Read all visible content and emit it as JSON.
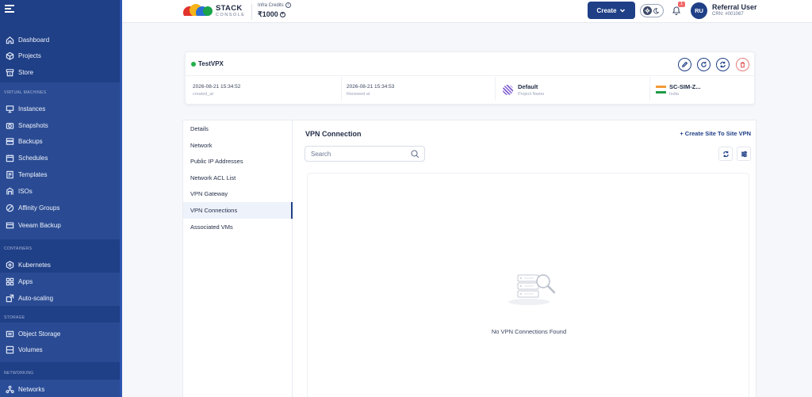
{
  "sidebar": {
    "items": [
      {
        "label": "Dashboard",
        "icon": "home-icon"
      },
      {
        "label": "Projects",
        "icon": "cube-icon"
      },
      {
        "label": "Store",
        "icon": "store-icon"
      }
    ],
    "sections": [
      {
        "title": "VIRTUAL MACHINES",
        "items": [
          {
            "label": "Instances",
            "icon": "instances-icon"
          },
          {
            "label": "Snapshots",
            "icon": "snapshot-icon"
          },
          {
            "label": "Backups",
            "icon": "backup-icon"
          },
          {
            "label": "Schedules",
            "icon": "calendar-icon"
          },
          {
            "label": "Templates",
            "icon": "template-icon"
          },
          {
            "label": "ISOs",
            "icon": "iso-icon"
          },
          {
            "label": "Affinity Groups",
            "icon": "affinity-icon"
          },
          {
            "label": "Veeam Backup",
            "icon": "veeam-icon"
          }
        ]
      },
      {
        "title": "CONTAINERS",
        "items": [
          {
            "label": "Kubernetes",
            "icon": "kubernetes-icon"
          },
          {
            "label": "Apps",
            "icon": "apps-icon"
          },
          {
            "label": "Auto-scaling",
            "icon": "autoscale-icon"
          }
        ]
      },
      {
        "title": "STORAGE",
        "items": [
          {
            "label": "Object Storage",
            "icon": "object-storage-icon"
          },
          {
            "label": "Volumes",
            "icon": "volumes-icon"
          }
        ]
      },
      {
        "title": "NETWORKING",
        "items": [
          {
            "label": "Networks",
            "icon": "network-icon"
          }
        ]
      }
    ]
  },
  "header": {
    "logo_title": "STACK",
    "logo_subtitle": "CONSOLE",
    "credits_label": "Infra Credits",
    "credits_value": "₹1000",
    "create_label": "Create",
    "notification_count": "1",
    "avatar_initials": "RU",
    "user_name": "Referral User",
    "user_crn": "CRN: #001067"
  },
  "instance": {
    "name": "TestVPX",
    "created_at": "2026-08-21 15:34:52",
    "created_at_label": "created_at",
    "renewed_at": "2026-08-21 15:34:53",
    "renewed_at_label": "Renewed at",
    "project": "Default",
    "project_label": "Project Name",
    "region": "SC-SIM-Z...",
    "region_label": "India",
    "status_color": "#22b14c"
  },
  "tabs": [
    "Details",
    "Network",
    "Public IP Addresses",
    "Network ACL List",
    "VPN Gateway",
    "VPN Connections",
    "Associated VMs"
  ],
  "active_tab": "VPN Connections",
  "vpn": {
    "title": "VPN Connection",
    "create_link": "+ Create Site To Site VPN",
    "search_placeholder": "Search",
    "empty_message": "No VPN Connections Found"
  },
  "colors": {
    "sidebar": "#1f3f86",
    "accent": "#1f3f86",
    "danger": "#e06060"
  }
}
